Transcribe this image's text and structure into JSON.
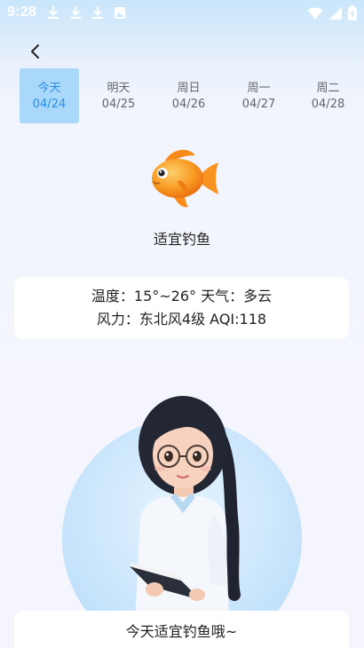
{
  "status_bar": {
    "time": "9:28",
    "icons": [
      "download-icon",
      "download-icon",
      "download-icon",
      "image-icon",
      "wifi-icon",
      "signal-icon",
      "battery-icon"
    ]
  },
  "nav": {
    "back_icon": "chevron-left-icon"
  },
  "tabs": [
    {
      "weekday": "今天",
      "date": "04/24",
      "active": true
    },
    {
      "weekday": "明天",
      "date": "04/25",
      "active": false
    },
    {
      "weekday": "周日",
      "date": "04/26",
      "active": false
    },
    {
      "weekday": "周一",
      "date": "04/27",
      "active": false
    },
    {
      "weekday": "周二",
      "date": "04/28",
      "active": false
    }
  ],
  "forecast": {
    "icon": "fish-icon",
    "verdict": "适宜钓鱼"
  },
  "weather": {
    "line1": "温度：15°~26° 天气：多云",
    "line2": "风力：东北风4级  AQI:118"
  },
  "message": {
    "text": "今天适宜钓鱼哦~"
  },
  "colors": {
    "accent": "#2b8ee6",
    "active_tab_bg": "#a9d8fb",
    "fish_orange": "#f7931e"
  }
}
